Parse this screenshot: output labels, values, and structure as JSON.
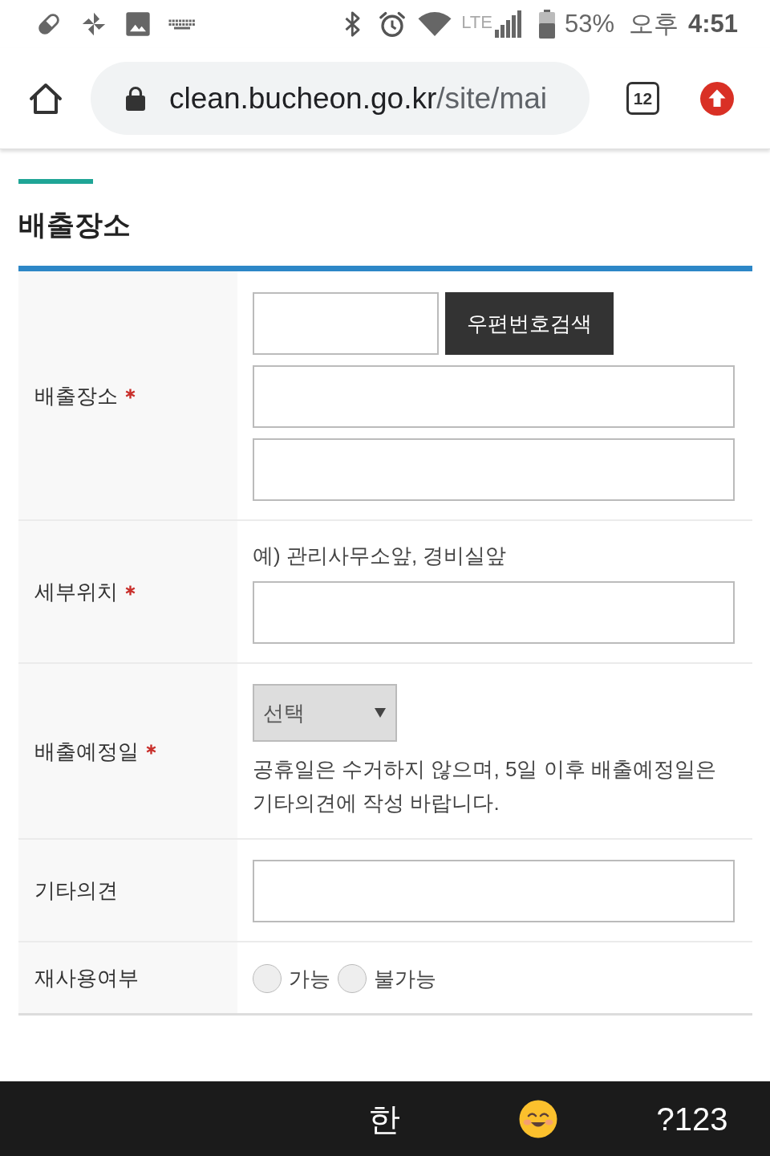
{
  "status_bar": {
    "network": "LTE",
    "battery": "53%",
    "period": "오후",
    "time": "4:51"
  },
  "browser": {
    "url_host": "clean.bucheon.go.kr",
    "url_path": "/site/mai",
    "tab_count": "12"
  },
  "section": {
    "title": "배출장소"
  },
  "form": {
    "rows": [
      {
        "label": "배출장소",
        "required": true,
        "fields": [
          {
            "kind": "postcode",
            "button": "우편번호검색"
          },
          {
            "kind": "input"
          },
          {
            "kind": "input"
          }
        ]
      },
      {
        "label": "세부위치",
        "required": true,
        "fields": [
          {
            "kind": "hint",
            "text": "예) 관리사무소앞, 경비실앞"
          },
          {
            "kind": "input"
          }
        ]
      },
      {
        "label": "배출예정일",
        "required": true,
        "fields": [
          {
            "kind": "select",
            "value": "선택"
          },
          {
            "kind": "note",
            "text": "공휴일은 수거하지 않으며, 5일 이후 배출예정일은 기타의견에 작성 바랍니다."
          }
        ]
      },
      {
        "label": "기타의견",
        "required": false,
        "fields": [
          {
            "kind": "input"
          }
        ]
      },
      {
        "label": "재사용여부",
        "required": false,
        "fields": [
          {
            "kind": "radios",
            "options": [
              {
                "label": "가능",
                "selected": false
              },
              {
                "label": "불가능",
                "selected": false
              }
            ]
          }
        ]
      }
    ]
  },
  "keyboard": {
    "keys": [
      {
        "kind": "text",
        "label": "한"
      },
      {
        "kind": "emoji"
      },
      {
        "kind": "text",
        "label": "?123"
      }
    ]
  }
}
